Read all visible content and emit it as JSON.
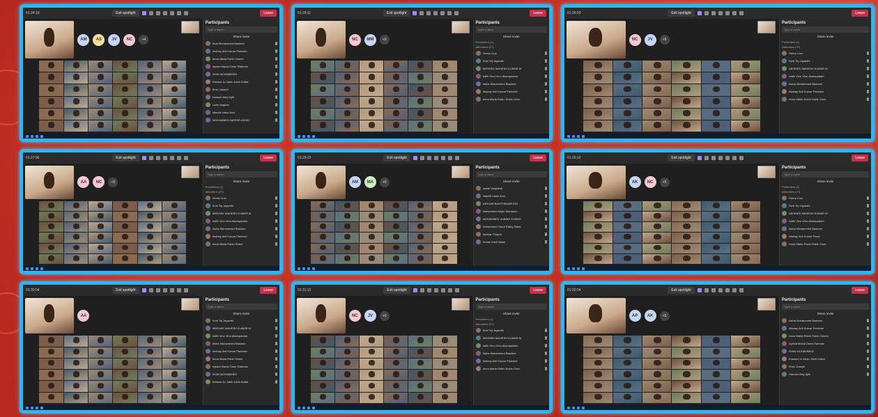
{
  "screens": [
    {
      "timer": "01:24:19",
      "spotlight": "Exit spotlight",
      "leave": "Leave",
      "panel_title": "Participants",
      "search_placeholder": "Type a name",
      "invite": "Share invite",
      "avatars": [
        {
          "initials": "AM",
          "color": "#c8d6f5"
        },
        {
          "initials": "AS",
          "color": "#f5dfa0"
        },
        {
          "initials": "JV",
          "color": "#c8d6f5"
        },
        {
          "initials": "NC",
          "color": "#f5c8d2"
        }
      ],
      "more": "+4",
      "sections": [],
      "participants": [
        "Nida Mohammed Basheer",
        "Akshay Anil Kumar Panicker",
        "Anna Maria Robin Oomm",
        "Ayisha Manal Omer Rahman",
        "AYAN MOHAMMED",
        "Edward Jo Jobin Jobin Kottar",
        "Enzo Joseph",
        "Hannah Aley Ajith",
        "Lexie Anghan",
        "Manelli Idaku Anvi",
        "MOHAMMED BASHIR ASHEL"
      ]
    },
    {
      "timer": "01:25:11",
      "spotlight": "Exit spotlight",
      "leave": "Leave",
      "panel_title": "Participants",
      "search_placeholder": "Type a name",
      "invite": "Share invite",
      "avatars": [
        {
          "initials": "NC",
          "color": "#f5c8d2"
        },
        {
          "initials": "MM",
          "color": "#c8d6f5"
        }
      ],
      "more": "+5",
      "sections": [
        "Presenters (1)",
        "Attendees (27)"
      ],
      "participants": [
        "Hema Cruz",
        "Ruhi Tej Jayanthi",
        "ABISHEK MAHESH KUMAR M",
        "Adith Vinu Vinu Akampadam",
        "Aisha Mohammed Basheer",
        "Akshay Anil Kumar Panicker",
        "Anna Maria Robin Robin Oom"
      ]
    },
    {
      "timer": "01:26:03",
      "spotlight": "Exit spotlight",
      "leave": "Leave",
      "panel_title": "Participants",
      "search_placeholder": "Type a name",
      "invite": "Share invite",
      "avatars": [
        {
          "initials": "NC",
          "color": "#f5c8d2"
        },
        {
          "initials": "JV",
          "color": "#c8d6f5"
        }
      ],
      "more": "+5",
      "sections": [
        "Presenters (1)",
        "Attendees (27)"
      ],
      "participants": [
        "Hema Cruz",
        "Ruhi Tej Jayanthi",
        "ABISHEK MAHESH KUMAR M",
        "Adith Vinu Vinu Akampadam",
        "Aisha Mohammed Basheer",
        "Akshay Anil Kumar Panicker",
        "Anna Maria Robin Robin Oom"
      ]
    },
    {
      "timer": "01:27:06",
      "spotlight": "Exit spotlight",
      "leave": "Leave",
      "panel_title": "Participants",
      "search_placeholder": "Type a name",
      "invite": "Share invite",
      "avatars": [
        {
          "initials": "AA",
          "color": "#f5c8d2"
        },
        {
          "initials": "NC",
          "color": "#f5c8d2"
        }
      ],
      "more": "+5",
      "sections": [
        "Presenters (1)",
        "Attendees (27)"
      ],
      "participants": [
        "Hema Cruz",
        "Ruhi Tej Jayanthi",
        "ABISHEK MAHESH KUMAR M",
        "Adith Vinu Vinu Akampadam",
        "Aisha Mohammed Basheer",
        "Akshay Anil Kumar Panicker",
        "Anna Maria Robin Robin"
      ]
    },
    {
      "timer": "01:28:23",
      "spotlight": "Exit spotlight",
      "leave": "Leave",
      "panel_title": "Participants",
      "search_placeholder": "Type a name",
      "invite": "Share invite",
      "avatars": [
        {
          "initials": "AM",
          "color": "#c8d6f5"
        },
        {
          "initials": "MA",
          "color": "#cdeec0"
        }
      ],
      "more": "+5",
      "sections": [],
      "participants": [
        "Isaiah Varghese",
        "Manelli Idaku Anvi",
        "MIDHUN BAVITHMAAR EBI",
        "Mohammed Anjan Mohamm",
        "MUHAMMED ZUBAIR KUMAR",
        "Muhammed Yusuf Rafeq Sakib",
        "Nannar Chopra",
        "Rohan Hadi Nasal"
      ]
    },
    {
      "timer": "01:29:12",
      "spotlight": "Exit spotlight",
      "leave": "Leave",
      "panel_title": "Participants",
      "search_placeholder": "Type a name",
      "invite": "Share invite",
      "avatars": [
        {
          "initials": "AK",
          "color": "#c8d6f5"
        },
        {
          "initials": "NC",
          "color": "#f5c8d2"
        }
      ],
      "more": "+5",
      "sections": [
        "Presenters (1)",
        "Attendees (27)"
      ],
      "participants": [
        "Hema Cruz",
        "Ruhi Tej Jayanthi",
        "ABISHEK MAHESH KUMAR M",
        "Adith Vinu Vinu Akampadam",
        "Aisha Mohammed Basheer",
        "Akshay Anil Kumar Panic",
        "Anna Maria Robin Robin Oom"
      ]
    },
    {
      "timer": "01:30:04",
      "spotlight": "Exit spotlight",
      "leave": "Leave",
      "panel_title": "Participants",
      "search_placeholder": "Type a name",
      "invite": "Share invite",
      "avatars": [
        {
          "initials": "AA",
          "color": "#f5c8d2"
        }
      ],
      "more": "",
      "sections": [],
      "participants": [
        "Ruhi Tej Jayanthi",
        "ABISHEK MAHESH KUMAR M",
        "Adith Vinu Vinu Akampadam",
        "Aisha Mohammed Basheer",
        "Akshay Anil Kumar Panicker",
        "Anna Maria Robin Robin",
        "Ayisha Manal Omer Rahman",
        "AYAN MOHAMMED",
        "Edward Jo Jobin Jobin Kottar"
      ]
    },
    {
      "timer": "01:31:15",
      "spotlight": "Exit spotlight",
      "leave": "Leave",
      "panel_title": "Participants",
      "search_placeholder": "Type a name",
      "invite": "Share invite",
      "avatars": [
        {
          "initials": "NC",
          "color": "#f5c8d2"
        },
        {
          "initials": "JV",
          "color": "#c8d6f5"
        }
      ],
      "more": "+5",
      "sections": [
        "Presenters (1)",
        "Attendees (27)"
      ],
      "participants": [
        "Ruhi Tej Jayanthi",
        "ABISHEK MAHESH KUMAR M",
        "Adith Vinu Vinu Akampadam",
        "Aisha Mohammed Basheer",
        "Akshay Anil Kumar Panicker",
        "Anna Maria Robin Robin Oom"
      ]
    },
    {
      "timer": "01:32:04",
      "spotlight": "Exit spotlight",
      "leave": "Leave",
      "panel_title": "Participants",
      "search_placeholder": "Type a name",
      "invite": "Share invite",
      "avatars": [
        {
          "initials": "AP",
          "color": "#c8d6f5"
        },
        {
          "initials": "AK",
          "color": "#c8d6f5"
        }
      ],
      "more": "+5",
      "sections": [],
      "participants": [
        "Aisha Mohammed Basheer",
        "Akshay Anil Kumar Panicker",
        "Anna Maria Robin Robin Oomm",
        "Ayisha Manal Omer Rahman",
        "AYAN MOHAMMED",
        "Edward Jo Jobin Jobin Kottar",
        "Enzo Joseph",
        "Hannah Aley Ajith"
      ]
    }
  ],
  "colors": {
    "frame": "#2fb6f0",
    "leave": "#c4314b",
    "accent": "#9b8cf5",
    "background": "#b8261f"
  }
}
